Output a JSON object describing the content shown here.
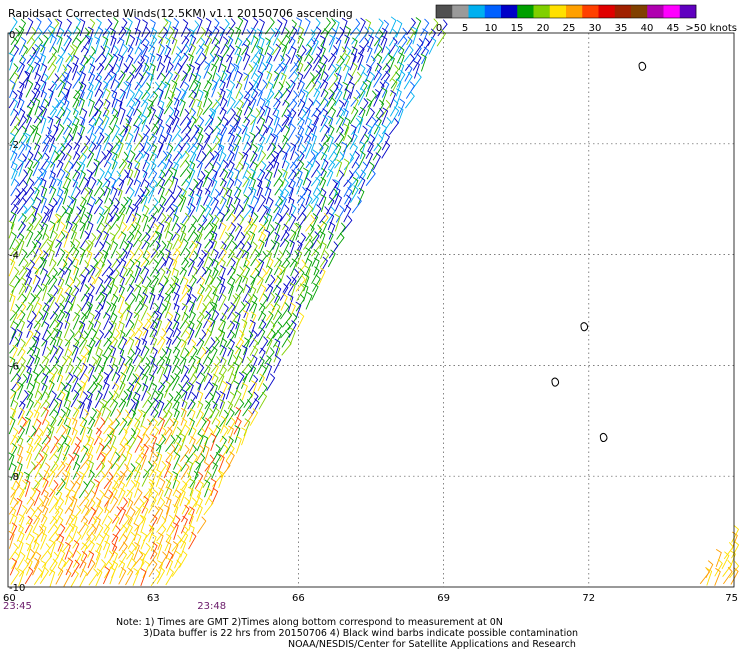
{
  "chart_data": {
    "type": "wind-barb-map",
    "title": "Rapidsact Corrected Winds(12.5KM) v1.1 20150706 ascending",
    "x_ticks": [
      "60",
      "63",
      "66",
      "69",
      "72",
      "75"
    ],
    "x_values": [
      60,
      63,
      66,
      69,
      72,
      75
    ],
    "y_ticks": [
      "0",
      "-2",
      "-4",
      "-6",
      "-8",
      "-10"
    ],
    "y_values": [
      0,
      -2,
      -4,
      -6,
      -8,
      -10
    ],
    "xlim": [
      60,
      75
    ],
    "ylim": [
      -10,
      0
    ],
    "grid": true,
    "legend": {
      "position": "top-right",
      "labels": [
        "0",
        "5",
        "10",
        "15",
        "20",
        "25",
        "30",
        "35",
        "40",
        "45",
        ">50 knots"
      ],
      "colors": [
        "#505050",
        "#9a9a9a",
        "#00b0f0",
        "#0060ff",
        "#0000c8",
        "#00a000",
        "#80d000",
        "#ffe000",
        "#ffa000",
        "#ff4000",
        "#e00000",
        "#a02000",
        "#804000",
        "#b000b0",
        "#ff00ff",
        "#6000c0"
      ]
    },
    "time_labels": [
      {
        "text": "23:45",
        "x": 60
      },
      {
        "text": "23:48",
        "x": 64.2
      }
    ],
    "notes": [
      "Note: 1) Times are GMT 2)Times along bottom correspond to measurement at 0N",
      "3)Data buffer is 22 hrs from 20150706 4) Black wind barbs indicate possible contamination",
      "NOAA/NESDIS/Center for Satellite Applications and Research"
    ],
    "swaths": [
      {
        "name": "",
        "polygon": [
          [
            60,
            0
          ],
          [
            69,
            0
          ],
          [
            63.4,
            -10
          ],
          [
            60,
            -10
          ]
        ]
      },
      {
        "name": "",
        "polygon": [
          [
            74.2,
            -10
          ],
          [
            75,
            -9.1
          ],
          [
            75,
            -10
          ]
        ]
      }
    ],
    "speed_zones": [
      {
        "lat_from": 0,
        "lat_to": -3.5,
        "speed_knots": 10
      },
      {
        "lat_from": -3.5,
        "lat_to": -7,
        "speed_knots": 15
      },
      {
        "lat_from": -7,
        "lat_to": -8.5,
        "speed_knots": 20
      },
      {
        "lat_from": -8.5,
        "lat_to": -10,
        "speed_knots": 25
      }
    ],
    "islands": [
      {
        "lon": 73.1,
        "lat": -0.6
      },
      {
        "lon": 71.9,
        "lat": -5.3
      },
      {
        "lon": 71.3,
        "lat": -6.3
      },
      {
        "lon": 72.3,
        "lat": -7.3
      }
    ]
  }
}
